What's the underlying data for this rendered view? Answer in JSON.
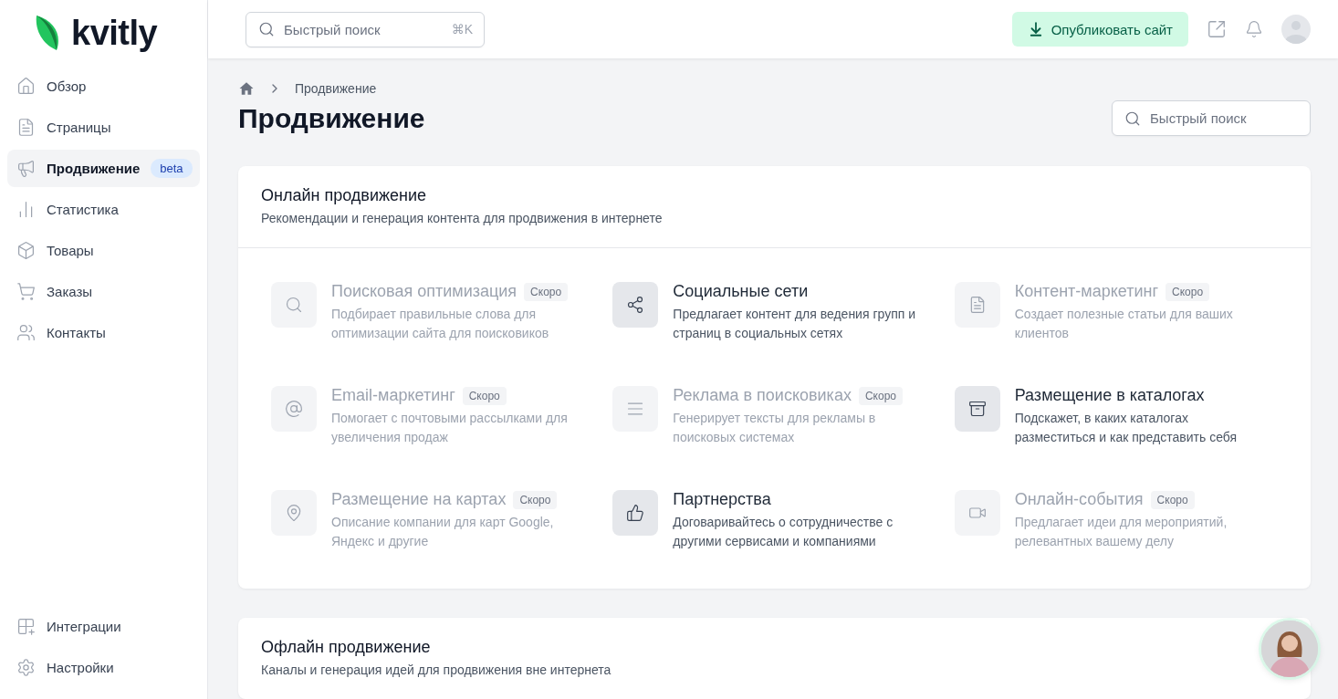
{
  "logo": {
    "text": "kvitly"
  },
  "sidebar": {
    "items": [
      {
        "label": "Обзор",
        "selected": false
      },
      {
        "label": "Страницы",
        "selected": false
      },
      {
        "label": "Продвижение",
        "selected": true,
        "badge": "beta"
      },
      {
        "label": "Статистика",
        "selected": false
      },
      {
        "label": "Товары",
        "selected": false
      },
      {
        "label": "Заказы",
        "selected": false
      },
      {
        "label": "Контакты",
        "selected": false
      }
    ],
    "bottom_items": [
      {
        "label": "Интеграции",
        "selected": false
      },
      {
        "label": "Настройки",
        "selected": false
      }
    ]
  },
  "topbar": {
    "search": {
      "placeholder": "Быстрый поиск",
      "shortcut": "⌘K"
    },
    "publish_button": "Опубликовать сайт"
  },
  "breadcrumb": [
    "Продвижение"
  ],
  "page_title": "Продвижение",
  "page_search": {
    "placeholder": "Быстрый поиск"
  },
  "sections": [
    {
      "title": "Онлайн продвижение",
      "subtitle": "Рекомендации и генерация контента для продвижения в интернете",
      "features": [
        {
          "title": "Поисковая оптимизация",
          "badge": "Скоро",
          "disabled": true,
          "description": "Подбирает правильные слова для оптимизации сайта для поисковиков"
        },
        {
          "title": "Социальные сети",
          "disabled": false,
          "description": "Предлагает контент для ведения групп и страниц в социальных сетях"
        },
        {
          "title": "Контент-маркетинг",
          "badge": "Скоро",
          "disabled": true,
          "description": "Создает полезные статьи для ваших клиентов"
        },
        {
          "title": "Email-маркетинг",
          "badge": "Скоро",
          "disabled": true,
          "description": "Помогает с почтовыми рассылками для увеличения продаж"
        },
        {
          "title": "Реклама в поисковиках",
          "badge": "Скоро",
          "disabled": true,
          "description": "Генерирует тексты для рекламы в поисковых системах"
        },
        {
          "title": "Размещение в каталогах",
          "disabled": false,
          "description": "Подскажет, в каких каталогах разместиться и как представить себя"
        },
        {
          "title": "Размещение на картах",
          "badge": "Скоро",
          "disabled": true,
          "description": "Описание компании для карт Google, Яндекс и другие"
        },
        {
          "title": "Партнерства",
          "disabled": false,
          "description": "Договаривайтесь о сотрудничестве с другими сервисами и компаниями"
        },
        {
          "title": "Онлайн-события",
          "badge": "Скоро",
          "disabled": true,
          "description": "Предлагает идеи для мероприятий, релевантных вашему делу"
        }
      ]
    },
    {
      "title": "Офлайн продвижение",
      "subtitle": "Каналы и генерация идей для продвижения вне интернета"
    }
  ]
}
